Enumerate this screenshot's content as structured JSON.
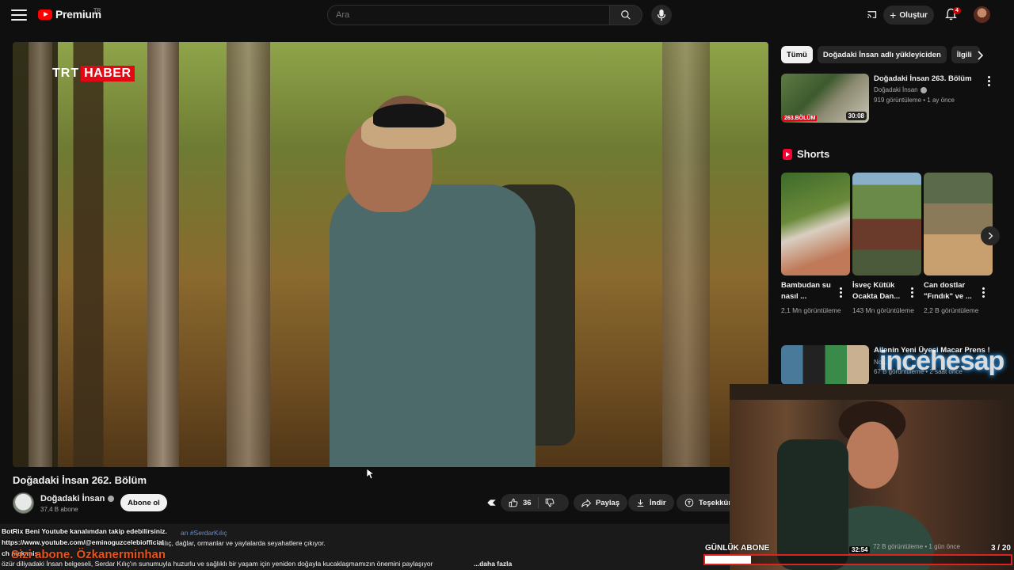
{
  "header": {
    "logo_text": "Premium",
    "logo_region": "TR",
    "search_placeholder": "Ara",
    "create_label": "Oluştur",
    "notification_count": "4",
    "icons": [
      "menu-icon",
      "youtube-logo-icon",
      "search-icon",
      "mic-icon",
      "cast-icon",
      "plus-icon",
      "bell-icon"
    ]
  },
  "player": {
    "watermark_a": "TRT",
    "watermark_b": "HABER"
  },
  "video": {
    "title": "Doğadaki İnsan 262. Bölüm",
    "channel": "Doğadaki İnsan",
    "subscribers": "37,4 B abone",
    "subscribe_label": "Abone ol",
    "likes": "36",
    "share_label": "Paylaş",
    "download_label": "İndir",
    "thanks_label": "Teşekkür"
  },
  "description": {
    "hashtag_fragment": "an #SerdarKılıç",
    "line2": "Kılıç, dağlar, ormanlar ve yaylalarda seyahatlere çıkıyor.",
    "line3_prefix": "özür diliyadaki İnsan belgeseli, Serdar Kılıç'ın sunumuyla huzurlu ve sağlıklı bir yaşam için yeniden doğayla kucaklaşmamızın önemini paylaşıyor",
    "more_label": "...daha fazla"
  },
  "chat_overlay": {
    "line1": "BotRix  Beni Youtube kanalımdan takip edebilirsiniz.",
    "line2": "https://www.youtube.com/@eminoguzcelebiofficial",
    "line3": "ch                              mek mis",
    "promo": "Sizi abone. Özkanerminhan"
  },
  "sidebar": {
    "chips": [
      "Tümü",
      "Doğadaki İnsan adlı yükleyiciden",
      "İlgili"
    ],
    "rec1": {
      "title": "Doğadaki İnsan 263. Bölüm",
      "channel": "Doğadaki İnsan",
      "meta": "919 görüntüleme • 1 ay önce",
      "duration": "30:08",
      "tag": "263.BÖLÜM"
    },
    "shorts_title": "Shorts",
    "shorts": [
      {
        "title": "Bambudan su nasıl ...",
        "views": "2,1 Mn görüntüleme"
      },
      {
        "title": "İsveç Kütük Ocakta Dan...",
        "views": "143 Mn görüntüleme"
      },
      {
        "title": "Can dostlar \"Fındık\" ve ...",
        "views": "2,2 B görüntüleme"
      }
    ],
    "rec2": {
      "title": "Ailenin Yeni Üyesi Macar Prens !",
      "channel": "No...",
      "meta": "67 B görüntüleme • 2 saat önce"
    }
  },
  "stream_overlay": {
    "brand": "incehesap",
    "goal_label": "GÜNLÜK ABONE",
    "goal_count": "3 / 20",
    "goal_progress": 0.15,
    "timestamp": "32:54",
    "meta_behind": "72 B görüntüleme • 1 gün önce"
  }
}
